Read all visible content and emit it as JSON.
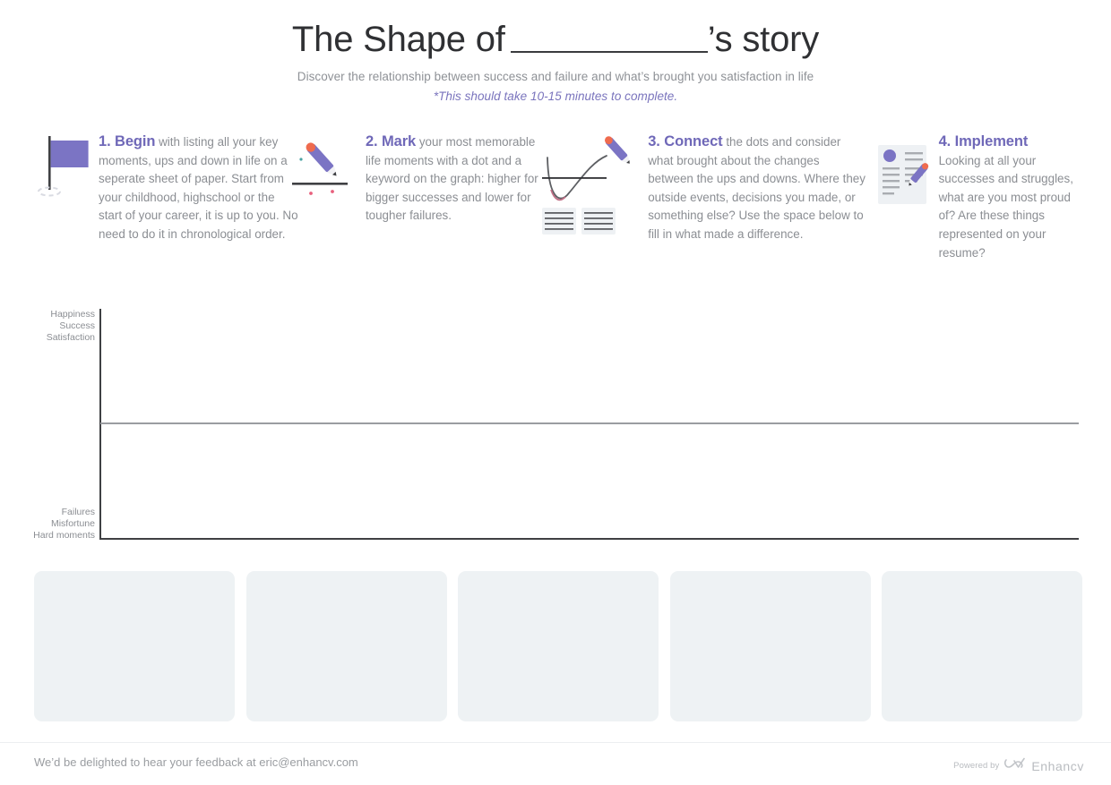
{
  "header": {
    "title_prefix": "The Shape of",
    "title_blank": "__________",
    "title_suffix": "’s story",
    "subtitle": "Discover the relationship between success and failure and what’s brought you satisfaction in life",
    "note": "*This should take 10-15 minutes to complete.",
    "title_color": "#2f3033",
    "note_color": "#7a74bd"
  },
  "accent_color": "#6f68b8",
  "body_text_color": "#8b8e93",
  "steps": [
    {
      "number": "1.",
      "head": "1. Begin",
      "icon": "flag-icon",
      "body": " with listing all your key moments, ups and down in life on a seperate sheet of paper. Start from your childhood, highschool or the start of your career, it is up to you. No need to do it in chronological order."
    },
    {
      "number": "2.",
      "head": "2. Mark",
      "icon": "pencil-line-icon",
      "body": " your most memorable life moments with a dot and a keyword on the graph: higher for bigger successes and lower for tougher failures."
    },
    {
      "number": "3.",
      "head": "3. Connect",
      "icon": "curve-graph-icon",
      "body": " the dots and consider what brought about the changes between the ups and downs. Where they outside events, decisions you  made, or something else? Use the space below to fill in what made a difference."
    },
    {
      "number": "4.",
      "head": "4. Implement",
      "icon": "resume-pencil-icon",
      "body": "Looking at all your successes and struggles, what are you most proud of? Are these things represented on your resume?"
    }
  ],
  "chart_data": {
    "type": "line",
    "title": "",
    "xlabel": "",
    "ylabel": "",
    "grid": false,
    "legend": false,
    "axis_top_labels": [
      "Happiness",
      "Success",
      "Satisfaction"
    ],
    "axis_bottom_labels": [
      "Failures",
      "Misfortune",
      "Hard moments"
    ],
    "series": [],
    "x": [],
    "ylim": [
      -1,
      1
    ],
    "note": "Empty plotting area for hand-drawn life-story curve; y axis spans Happiness/Success/Satisfaction at top to Failures/Misfortune/Hard moments at bottom, with a neutral mid-line."
  },
  "cards": {
    "count": 5,
    "fill_color": "#eef2f4",
    "items": [
      "",
      "",
      "",
      "",
      ""
    ]
  },
  "footer": {
    "feedback": "We’d be delighted to hear your feedback at eric@enhancv.com",
    "powered_by": "Powered by",
    "brand": "Enhancv"
  }
}
